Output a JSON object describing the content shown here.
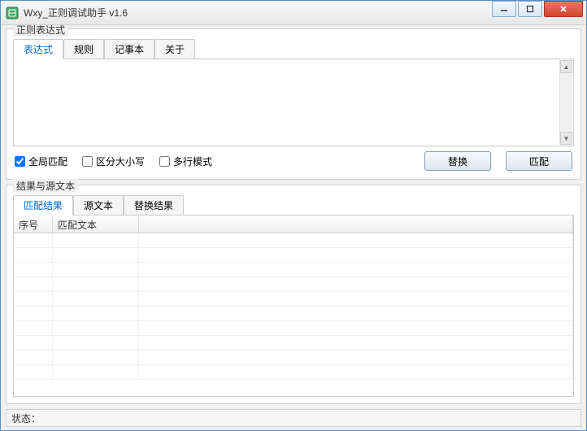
{
  "window": {
    "title": "Wxy_正则调试助手  v1.6"
  },
  "group1": {
    "legend": "正则表达式",
    "tabs": [
      "表达式",
      "规则",
      "记事本",
      "关于"
    ],
    "active_tab": 0,
    "textarea_value": "",
    "checkboxes": {
      "global": {
        "label": "全局匹配",
        "checked": true
      },
      "case": {
        "label": "区分大小写",
        "checked": false
      },
      "multiline": {
        "label": "多行模式",
        "checked": false
      }
    },
    "buttons": {
      "replace": "替换",
      "match": "匹配"
    }
  },
  "group2": {
    "legend": "结果与源文本",
    "tabs": [
      "匹配结果",
      "源文本",
      "替换结果"
    ],
    "active_tab": 0,
    "columns": [
      "序号",
      "匹配文本",
      ""
    ],
    "rows": []
  },
  "statusbar": {
    "label": "状态："
  }
}
